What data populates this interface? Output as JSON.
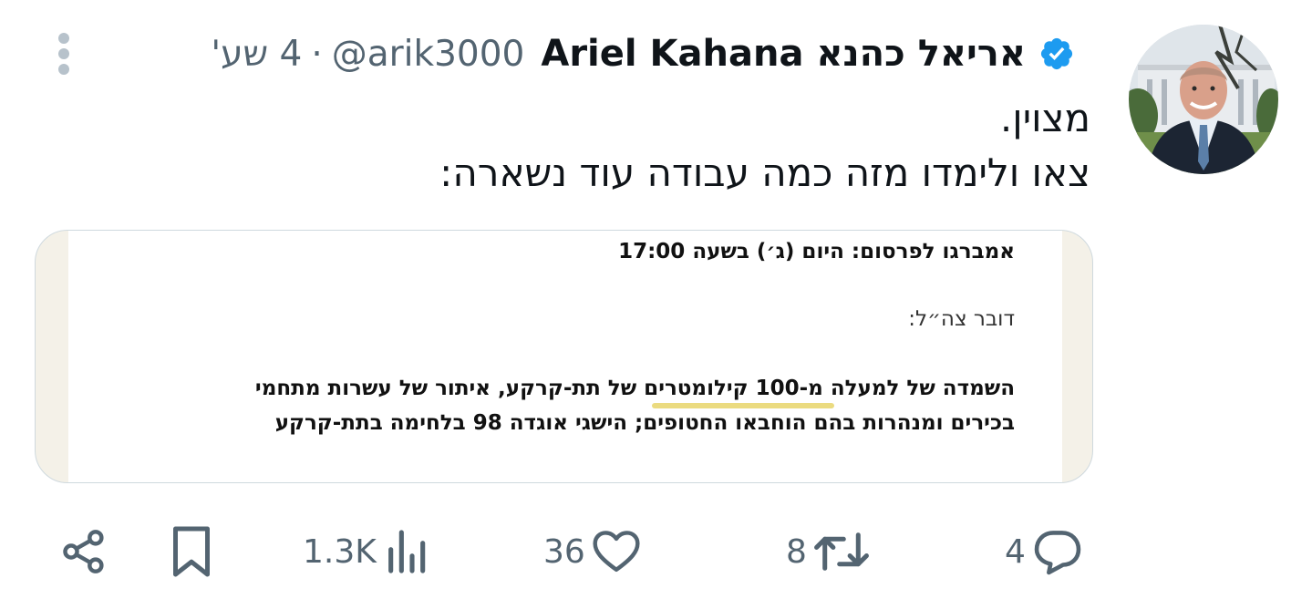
{
  "tweet": {
    "author": {
      "display_name": "אריאל כהנא Ariel Kahana",
      "handle": "@arik3000",
      "verified_icon": "verified-badge-icon",
      "avatar_icon": "profile-photo"
    },
    "separator": "·",
    "timestamp": "4 שע'",
    "more_icon": "more-options-icon",
    "text_lines": [
      "מצוין.",
      "צאו ולימדו מזה כמה עבודה עוד נשארה:"
    ]
  },
  "media": {
    "embargo": "אמברגו לפרסום: היום (ג׳) בשעה 17:00",
    "spokesperson": "דובר צה״ל:",
    "body_line_1": "השמדה של למעלה מ-100 קילומטרים של תת-קרקע, איתור של עשרות מתחמי",
    "body_line_2": "בכירים ומנהרות בהם הוחבאו החטופים; הישגי אוגדה 98 בלחימה בתת-קרקע"
  },
  "actions": {
    "reply": {
      "icon": "reply-icon",
      "count": "4"
    },
    "retweet": {
      "icon": "retweet-icon",
      "count": "8"
    },
    "like": {
      "icon": "like-heart-icon",
      "count": "36"
    },
    "views": {
      "icon": "views-chart-icon",
      "count": "1.3K"
    },
    "bookmark": {
      "icon": "bookmark-icon"
    },
    "share": {
      "icon": "share-icon"
    }
  },
  "colors": {
    "text_primary": "#0f1419",
    "text_secondary": "#536471",
    "verified_blue": "#1d9bf0",
    "border": "#cfd9de",
    "highlight": "#e7d56a"
  }
}
